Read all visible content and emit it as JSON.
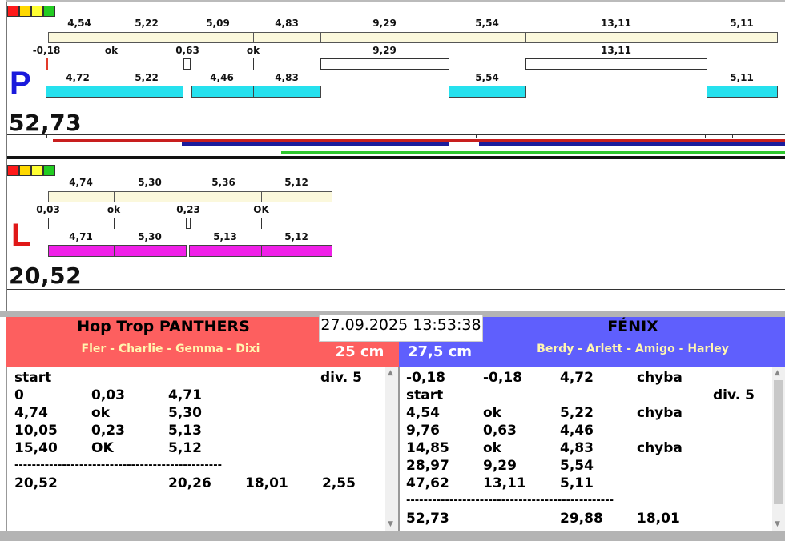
{
  "lights": [
    "#ff1a1a",
    "#ffd800",
    "#ffff33",
    "#22cc22"
  ],
  "right": {
    "letter": "P",
    "total": "52,73",
    "top_labels": [
      "4,54",
      "5,22",
      "5,09",
      "4,83",
      "9,29",
      "5,54",
      "13,11",
      "5,11"
    ],
    "mid_labels": [
      "-0,18",
      "ok",
      "0,63",
      "ok",
      "9,29",
      "13,11"
    ],
    "bottom_labels": [
      "4,72",
      "5,22",
      "4,46",
      "4,83",
      "5,54",
      "5,11"
    ]
  },
  "left": {
    "letter": "L",
    "total": "20,52",
    "top_labels": [
      "4,74",
      "5,30",
      "5,36",
      "5,12"
    ],
    "mid_labels": [
      "0,03",
      "ok",
      "0,23",
      "OK"
    ],
    "bottom_labels": [
      "4,71",
      "5,30",
      "5,13",
      "5,12"
    ]
  },
  "datetime": "27.09.2025 13:53:38",
  "team_left": {
    "name": "Hop Trop PANTHERS",
    "dogs": "Fler - Charlie - Gemma - Dixi",
    "height": "25 cm",
    "color": "#fd5f5f",
    "rows": [
      [
        "start",
        "",
        "",
        "",
        "div.  5"
      ],
      [
        "0",
        "0,03",
        "4,71",
        "",
        ""
      ],
      [
        "4,74",
        "ok",
        "5,30",
        "",
        ""
      ],
      [
        "10,05",
        "0,23",
        "5,13",
        "",
        ""
      ],
      [
        "15,40",
        "OK",
        "5,12",
        "",
        ""
      ]
    ],
    "separator": "------------------------------------------------",
    "summary": [
      "20,52",
      "",
      "20,26",
      "18,01",
      "2,55"
    ]
  },
  "team_right": {
    "name": "FÉNIX",
    "dogs": "Berdy - Arlett - Amigo - Harley",
    "height": "27,5 cm",
    "color": "#5f5ffd",
    "rows": [
      [
        "-0,18",
        "-0,18",
        "4,72",
        "chyba",
        ""
      ],
      [
        "start",
        "",
        "",
        "",
        "div.  5"
      ],
      [
        "4,54",
        "ok",
        "5,22",
        "chyba",
        ""
      ],
      [
        "9,76",
        "0,63",
        "4,46",
        "",
        ""
      ],
      [
        "14,85",
        "ok",
        "4,83",
        "chyba",
        ""
      ],
      [
        "28,97",
        "9,29",
        "5,54",
        "",
        ""
      ],
      [
        "47,62",
        "13,11",
        "5,11",
        "",
        ""
      ]
    ],
    "separator": "------------------------------------------------",
    "summary": [
      "52,73",
      "",
      "29,88",
      "18,01",
      ""
    ]
  }
}
